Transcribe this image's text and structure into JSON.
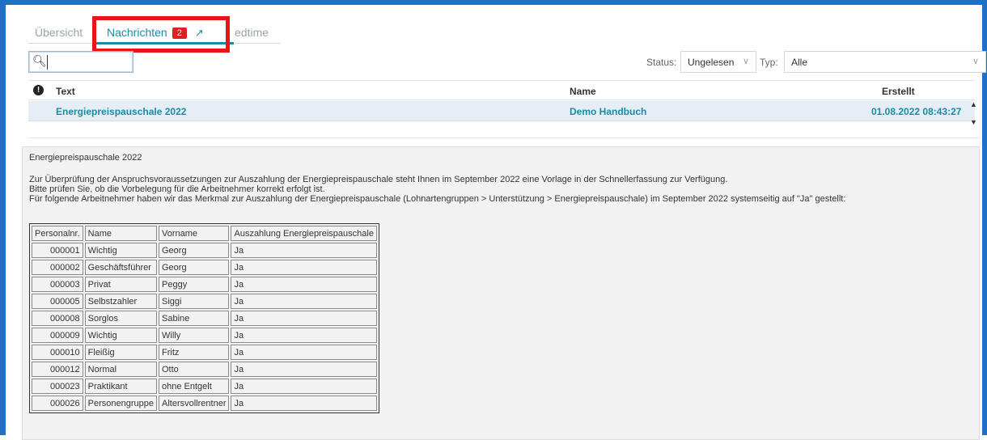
{
  "tabs": {
    "overview": "Übersicht",
    "messages": "Nachrichten",
    "messages_badge": "2",
    "third_partial": "edtime"
  },
  "search": {
    "placeholder": "",
    "value": ""
  },
  "filters": {
    "status_label": "Status:",
    "status_value": "Ungelesen",
    "type_label": "Typ:",
    "type_value": "Alle"
  },
  "list": {
    "headers": {
      "text": "Text",
      "name": "Name",
      "created": "Erstellt"
    },
    "rows": [
      {
        "text": "Energiepreispauschale 2022",
        "name": "Demo Handbuch",
        "created": "01.08.2022 08:43:27"
      }
    ]
  },
  "detail": {
    "title": "Energiepreispauschale 2022",
    "paragraph1": "Zur Überprüfung der Anspruchsvoraussetzungen zur Auszahlung der Energiepreispauschale steht Ihnen im September 2022 eine Vorlage in der Schnellerfassung zur Verfügung.",
    "paragraph2": "Bitte prüfen Sie, ob die Vorbelegung für die Arbeitnehmer korrekt erfolgt ist.",
    "paragraph3": "Für folgende Arbeitnehmer haben wir das Merkmal zur Auszahlung der Energiepreispauschale (Lohnartengruppen > Unterstützung > Energiepreispauschale) im September 2022 systemseitig auf \"Ja\" gestellt:",
    "table": {
      "headers": [
        "Personalnr.",
        "Name",
        "Vorname",
        "Auszahlung Energiepreispauschale"
      ],
      "rows": [
        [
          "000001",
          "Wichtig",
          "Georg",
          "Ja"
        ],
        [
          "000002",
          "Geschäftsführer",
          "Georg",
          "Ja"
        ],
        [
          "000003",
          "Privat",
          "Peggy",
          "Ja"
        ],
        [
          "000005",
          "Selbstzahler",
          "Siggi",
          "Ja"
        ],
        [
          "000008",
          "Sorglos",
          "Sabine",
          "Ja"
        ],
        [
          "000009",
          "Wichtig",
          "Willy",
          "Ja"
        ],
        [
          "000010",
          "Fleißig",
          "Fritz",
          "Ja"
        ],
        [
          "000012",
          "Normal",
          "Otto",
          "Ja"
        ],
        [
          "000023",
          "Praktikant",
          "ohne Entgelt",
          "Ja"
        ],
        [
          "000026",
          "Personengruppe",
          "Altersvollrentner",
          "Ja"
        ]
      ]
    }
  },
  "colors": {
    "accent": "#1d8aa4",
    "frame": "#1f6fc6",
    "highlight": "#e8141a",
    "badge": "#e02020",
    "selected_row": "#e5eef7"
  },
  "icons": {
    "search": "search-icon",
    "alert": "alert-icon",
    "external": "external-link-icon",
    "chevron": "chevron-down-icon"
  }
}
